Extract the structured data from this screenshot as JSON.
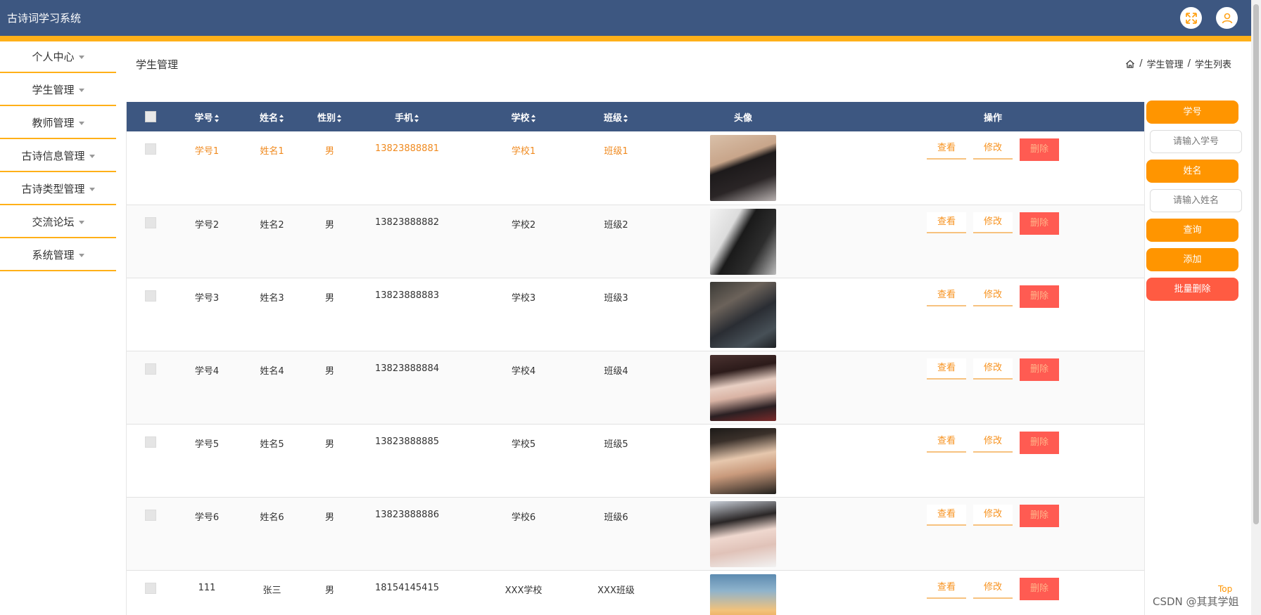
{
  "app": {
    "title": "古诗词学习系统"
  },
  "sidebar": {
    "items": [
      {
        "label": "个人中心"
      },
      {
        "label": "学生管理"
      },
      {
        "label": "教师管理"
      },
      {
        "label": "古诗信息管理"
      },
      {
        "label": "古诗类型管理"
      },
      {
        "label": "交流论坛"
      },
      {
        "label": "系统管理"
      }
    ]
  },
  "page": {
    "title": "学生管理",
    "breadcrumb": [
      "学生管理",
      "学生列表"
    ],
    "breadcrumb_sep": "/"
  },
  "table": {
    "headers": {
      "id": "学号",
      "name": "姓名",
      "gender": "性别",
      "phone": "手机",
      "school": "学校",
      "class": "班级",
      "avatar": "头像",
      "ops": "操作"
    },
    "rows": [
      {
        "id": "学号1",
        "name": "姓名1",
        "gender": "男",
        "phone": "13823888881",
        "school": "学校1",
        "class": "班级1"
      },
      {
        "id": "学号2",
        "name": "姓名2",
        "gender": "男",
        "phone": "13823888882",
        "school": "学校2",
        "class": "班级2"
      },
      {
        "id": "学号3",
        "name": "姓名3",
        "gender": "男",
        "phone": "13823888883",
        "school": "学校3",
        "class": "班级3"
      },
      {
        "id": "学号4",
        "name": "姓名4",
        "gender": "男",
        "phone": "13823888884",
        "school": "学校4",
        "class": "班级4"
      },
      {
        "id": "学号5",
        "name": "姓名5",
        "gender": "男",
        "phone": "13823888885",
        "school": "学校5",
        "class": "班级5"
      },
      {
        "id": "学号6",
        "name": "姓名6",
        "gender": "男",
        "phone": "13823888886",
        "school": "学校6",
        "class": "班级6"
      },
      {
        "id": "111",
        "name": "张三",
        "gender": "男",
        "phone": "18154145415",
        "school": "XXX学校",
        "class": "XXX班级"
      }
    ],
    "actions": {
      "view": "查看",
      "edit": "修改",
      "delete": "删除"
    }
  },
  "search": {
    "id_label": "学号",
    "id_placeholder": "请输入学号",
    "name_label": "姓名",
    "name_placeholder": "请输入姓名",
    "query": "查询",
    "add": "添加",
    "batch_delete": "批量删除"
  },
  "footer": {
    "top_link": "Top",
    "watermark": "CSDN @其其学姐"
  },
  "colors": {
    "header_bg": "#3d5781",
    "accent": "#ffb018",
    "button_orange": "#ff9500",
    "button_red": "#ff5b42"
  },
  "icons": {
    "fullscreen": "fullscreen-icon",
    "user": "user-icon",
    "home": "home-icon"
  }
}
